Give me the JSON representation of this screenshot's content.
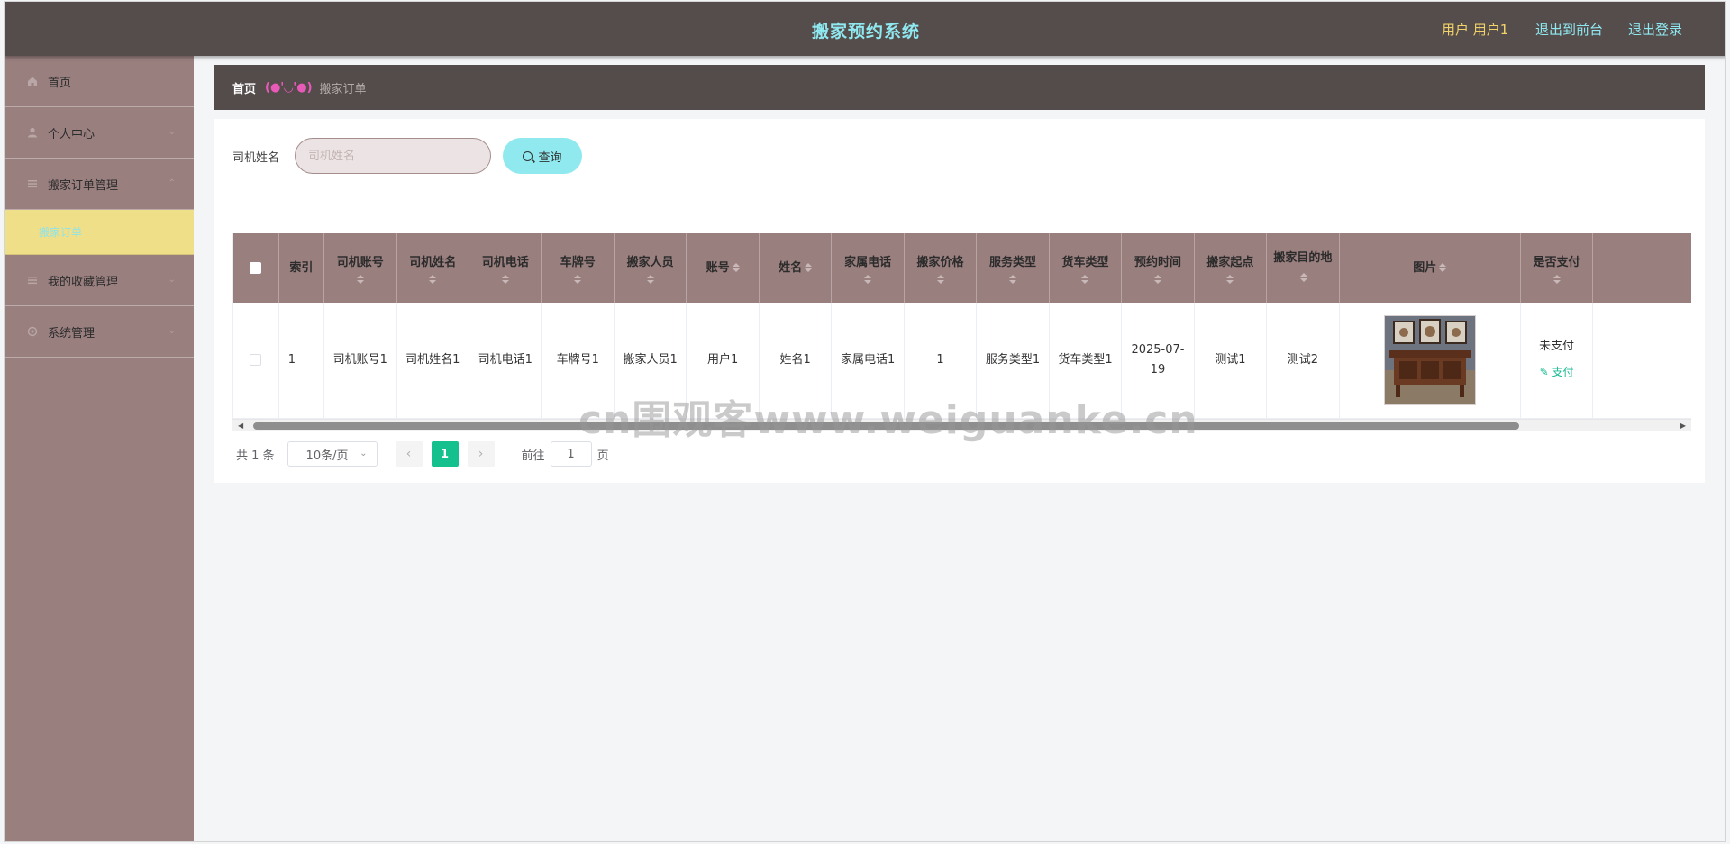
{
  "header": {
    "title": "搬家预约系统",
    "user": "用户 用户1",
    "to_front": "退出到前台",
    "logout": "退出登录"
  },
  "sidebar": {
    "items": [
      {
        "label": "首页",
        "icon": "home-icon"
      },
      {
        "label": "个人中心",
        "icon": "user-icon"
      },
      {
        "label": "搬家订单管理",
        "icon": "list-icon",
        "expanded": true
      },
      {
        "label": "我的收藏管理",
        "icon": "list-icon"
      },
      {
        "label": "系统管理",
        "icon": "settings-icon"
      }
    ],
    "sub_item": "搬家订单"
  },
  "breadcrumb": {
    "home": "首页",
    "emoji": "(●'◡'●)",
    "current": "搬家订单"
  },
  "search": {
    "label": "司机姓名",
    "placeholder": "司机姓名",
    "button": "查询"
  },
  "table": {
    "headers": [
      "索引",
      "司机账号",
      "司机姓名",
      "司机电话",
      "车牌号",
      "搬家人员",
      "账号",
      "姓名",
      "家属电话",
      "搬家价格",
      "服务类型",
      "货车类型",
      "预约时间",
      "搬家起点",
      "搬家目的地",
      "图片",
      "是否支付"
    ],
    "rows": [
      {
        "index": "1",
        "driver_account": "司机账号1",
        "driver_name": "司机姓名1",
        "driver_phone": "司机电话1",
        "plate": "车牌号1",
        "movers": "搬家人员1",
        "account": "用户1",
        "name": "姓名1",
        "family_phone": "家属电话1",
        "price": "1",
        "service_type": "服务类型1",
        "truck_type": "货车类型1",
        "time": "2025-07-19",
        "from": "测试1",
        "to": "测试2",
        "paid_status": "未支付",
        "pay_action": "支付"
      }
    ]
  },
  "pagination": {
    "total": "共 1 条",
    "page_size": "10条/页",
    "current_page": "1",
    "goto_label": "前往",
    "goto_value": "1",
    "page_unit": "页"
  },
  "watermark": "cn围观客www.weiguanke.cn",
  "colors": {
    "header_bg": "#554c4c",
    "sidebar_bg": "#9a7f7f",
    "active_sub_bg": "#efdf88",
    "accent_cyan": "#8fe9ee",
    "page_active": "#13c08e"
  }
}
